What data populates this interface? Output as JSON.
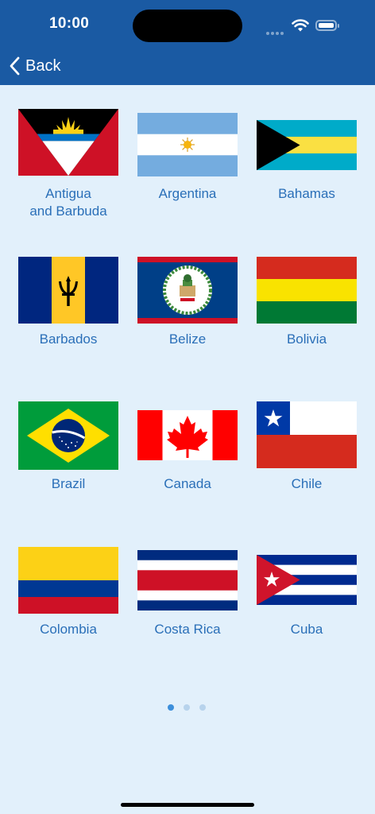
{
  "status_bar": {
    "time": "10:00"
  },
  "nav": {
    "back_label": "Back"
  },
  "flags": [
    {
      "name": "Antigua and Barbuda",
      "line1": "Antigua",
      "line2": "and Barbuda"
    },
    {
      "name": "Argentina"
    },
    {
      "name": "Bahamas"
    },
    {
      "name": "Barbados"
    },
    {
      "name": "Belize"
    },
    {
      "name": "Bolivia"
    },
    {
      "name": "Brazil"
    },
    {
      "name": "Canada"
    },
    {
      "name": "Chile"
    },
    {
      "name": "Colombia"
    },
    {
      "name": "Costa Rica"
    },
    {
      "name": "Cuba"
    }
  ],
  "pagination": {
    "pages": 3,
    "current": 1
  },
  "colors": {
    "header": "#1a5aa3",
    "background": "#e2f0fb",
    "label": "#2a6fb8",
    "dot_active": "#3d8fdb",
    "dot_inactive": "#b7d3ec"
  }
}
